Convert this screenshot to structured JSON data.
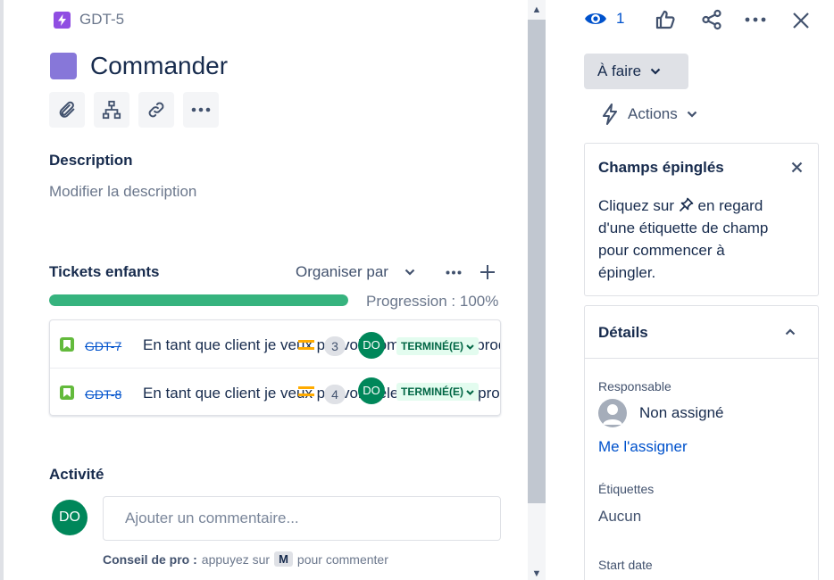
{
  "issue": {
    "key": "GDT-5",
    "title": "Commander",
    "epic_color": "#8777D9"
  },
  "toolbar": {
    "attach_icon": "paperclip-icon",
    "child_icon": "hierarchy-icon",
    "link_icon": "link-icon",
    "more_icon": "more-icon"
  },
  "description": {
    "heading": "Description",
    "placeholder": "Modifier la description"
  },
  "children": {
    "heading": "Tickets enfants",
    "organize_label": "Organiser par",
    "progress_label": "Progression : 100%",
    "progress": 1.0,
    "items": [
      {
        "key": "GDT-7",
        "summary": "En tant que client je veux pouvoir commander un produit alim",
        "estimate": "3",
        "assignee_initials": "DO",
        "status": "TERMINÉ(E)"
      },
      {
        "key": "GDT-8",
        "summary": "En tant que client je veux pouvoir sélectionner un produit",
        "estimate": "4",
        "assignee_initials": "DO",
        "status": "TERMINÉ(E)"
      }
    ]
  },
  "activity": {
    "heading": "Activité",
    "user_initials": "DO",
    "comment_placeholder": "Ajouter un commentaire...",
    "tip_label": "Conseil de pro :",
    "tip_text": "appuyez sur",
    "tip_key": "M",
    "tip_suffix": "pour commenter"
  },
  "header_actions": {
    "watchers_count": "1"
  },
  "status": {
    "label": "À faire"
  },
  "actions": {
    "label": "Actions"
  },
  "pinned": {
    "title": "Champs épinglés",
    "line1_before": "Cliquez sur",
    "line1_after": "en regard",
    "line2": "d'une étiquette de champ",
    "line3": "pour commencer à",
    "line4": "épingler."
  },
  "details": {
    "title": "Détails",
    "assignee_label": "Responsable",
    "assignee_value": "Non assigné",
    "assign_me": "Me l'assigner",
    "labels_label": "Étiquettes",
    "labels_value": "Aucun",
    "start_date_label": "Start date"
  },
  "colors": {
    "success": "#36B37E",
    "link": "#0052CC",
    "avatar": "#00875A",
    "status_bg": "#E3FCEF",
    "status_text": "#006644"
  }
}
